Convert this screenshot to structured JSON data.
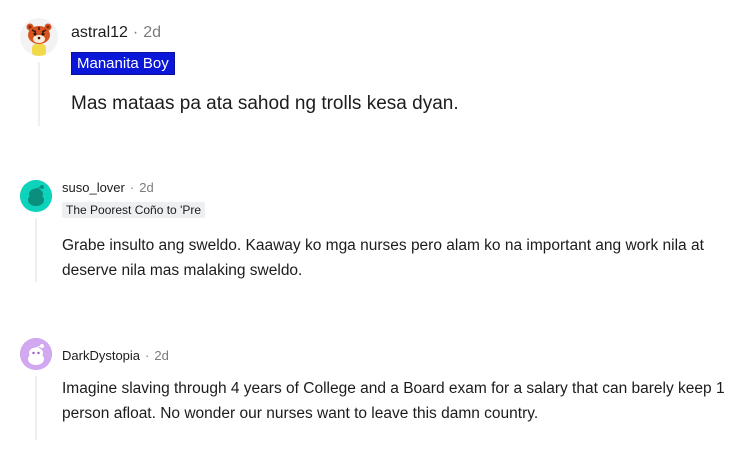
{
  "comments": [
    {
      "username": "astral12",
      "separator": "·",
      "time": "2d",
      "flair": "Mananita Boy",
      "body": "Mas mataas pa ata sahod ng trolls kesa dyan.",
      "avatar_icon": "tiger-avatar-icon",
      "accent": "#0a16d8"
    },
    {
      "username": "suso_lover",
      "separator": "·",
      "time": "2d",
      "flair": "The Poorest Coño to 'Pre",
      "body": "Grabe insulto ang sweldo. Kaaway ko mga nurses pero alam ko na important ang work nila at deserve nila mas malaking sweldo.",
      "avatar_icon": "snoo-avatar-icon",
      "accent": "#0dd3bb"
    },
    {
      "username": "DarkDystopia",
      "separator": "·",
      "time": "2d",
      "body": "Imagine slaving through 4 years of College and a Board exam for a salary that can barely keep 1 person afloat. No wonder our nurses want to leave this damn country.",
      "avatar_icon": "snoo-avatar-icon",
      "accent": "#c18de8"
    }
  ]
}
